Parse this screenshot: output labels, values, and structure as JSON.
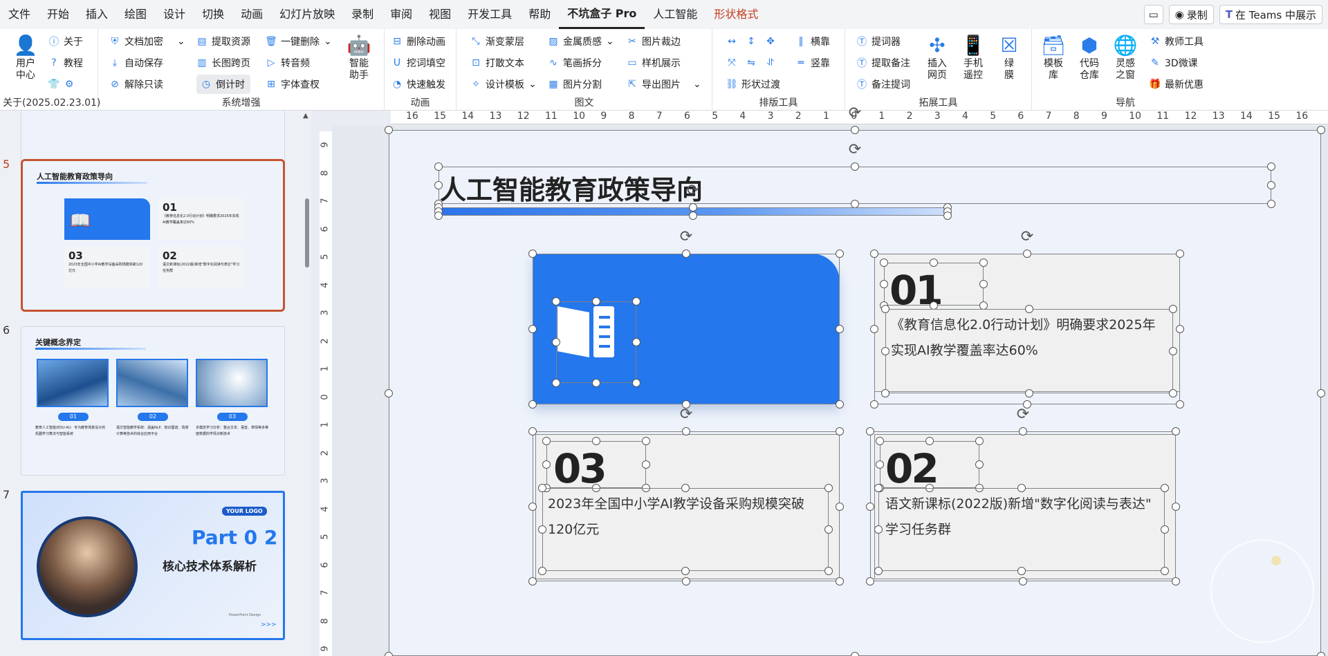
{
  "menu": [
    "文件",
    "开始",
    "插入",
    "绘图",
    "设计",
    "切换",
    "动画",
    "幻灯片放映",
    "录制",
    "审阅",
    "视图",
    "开发工具",
    "帮助",
    "不坑盒子 Pro",
    "人工智能",
    "形状格式"
  ],
  "menu_active": "不坑盒子 Pro",
  "menubar_right": {
    "record": "录制",
    "teams": "在 Teams 中展示"
  },
  "ribbon": {
    "user_center": "用户中心",
    "about": "关于",
    "tutorial": "教程",
    "version": "关于(2025.02.23.01)",
    "sys": {
      "doc_encrypt": "文档加密",
      "auto_save": "自动保存",
      "unlock_readonly": "解除只读",
      "extract_res": "提取资源",
      "long_img": "长图跨页",
      "countdown": "倒计时",
      "one_delete": "一键删除",
      "to_audio": "转音频",
      "font_check": "字体查杈",
      "assistant": "智能助手",
      "label": "系统增强"
    },
    "anim": {
      "del_anim": "删除动画",
      "cloze": "挖词填空",
      "quick_trigger": "快速触发",
      "label": "动画"
    },
    "img": {
      "gradient_mask": "渐变蒙层",
      "scatter_text": "打散文本",
      "design_tpl": "设计模板",
      "metal": "金属质感",
      "stroke_split": "笔画拆分",
      "img_split": "图片分割",
      "img_crop": "图片裁边",
      "sample_show": "样机展示",
      "export_img": "导出图片",
      "label": "图文"
    },
    "layout": {
      "h_align": "横靠",
      "v_align": "竖靠",
      "shape_transition": "形状过渡",
      "label": "排版工具"
    },
    "ext": {
      "prompter": "提词器",
      "extract_notes": "提取备注",
      "notes_prompt": "备注提词",
      "insert_web": "插入网页",
      "phone_remote": "手机遥控",
      "green_film": "绿膜",
      "label": "拓展工具"
    },
    "nav": {
      "tpl_lib": "模板库",
      "code_lib": "代码仓库",
      "inspire": "灵感之窗",
      "teacher_tools": "教师工具",
      "micro3d": "3D微课",
      "latest_deals": "最新优惠",
      "label": "导航"
    }
  },
  "slides": [
    {
      "no": "5",
      "title": "人工智能教育政策导向",
      "items": [
        {
          "num": "01",
          "text": "《教育信息化2.0行动计划》明确要求2025年实现AI教学覆盖率达60%"
        },
        {
          "num": "03",
          "text": "2023年全国中小学AI教学设备采购规模突破120亿元"
        },
        {
          "num": "02",
          "text": "语文新课标(2022版)新增\"数字化阅读与表达\"学习任务群"
        }
      ]
    },
    {
      "no": "6",
      "title": "关键概念界定",
      "badges": [
        "01",
        "02",
        "03"
      ],
      "captions": [
        "教育人工智能(EDU-AI)：专为教育场景设计的机器学习算法与智能系统",
        "语文智能教学系统：涵盖NLP、知识图谱、情感计算等技术的综合应用平台",
        "多模态学习分析：整合文本、语音、表情等多维度数据的学情诊断技术"
      ]
    },
    {
      "no": "7",
      "logo": "YOUR LOGO",
      "part": "Part 0 2",
      "subtitle": "核心技术体系解析",
      "small": "PowerPoint Design",
      "arrows": ">>>"
    }
  ],
  "main": {
    "title": "人工智能教育政策导向",
    "cards": [
      {
        "num": "01",
        "line1": "《教育信息化2.0行动计划》明确要求2025年",
        "line2": "实现AI教学覆盖率达60%"
      },
      {
        "num": "03",
        "line1": "2023年全国中小学AI教学设备采购规模突破",
        "line2": "120亿元"
      },
      {
        "num": "02",
        "line1": "语文新课标(2022版)新增\"数字化阅读与表达\"",
        "line2": "学习任务群"
      }
    ]
  },
  "ruler_top": [
    "16",
    "15",
    "14",
    "13",
    "12",
    "11",
    "10",
    "9",
    "8",
    "7",
    "6",
    "5",
    "4",
    "3",
    "2",
    "1",
    "0",
    "1",
    "2",
    "3",
    "4",
    "5",
    "6",
    "7",
    "8",
    "9",
    "10",
    "11",
    "12",
    "13",
    "14",
    "15",
    "16"
  ],
  "ruler_left": [
    "9",
    "8",
    "7",
    "6",
    "5",
    "4",
    "3",
    "2",
    "1",
    "0",
    "1",
    "2",
    "3",
    "4",
    "5",
    "6",
    "7",
    "8",
    "9"
  ],
  "colors": {
    "accent": "#2477ec",
    "selected_thumb": "#c65332",
    "shape_format_tab": "#c43b1d"
  }
}
